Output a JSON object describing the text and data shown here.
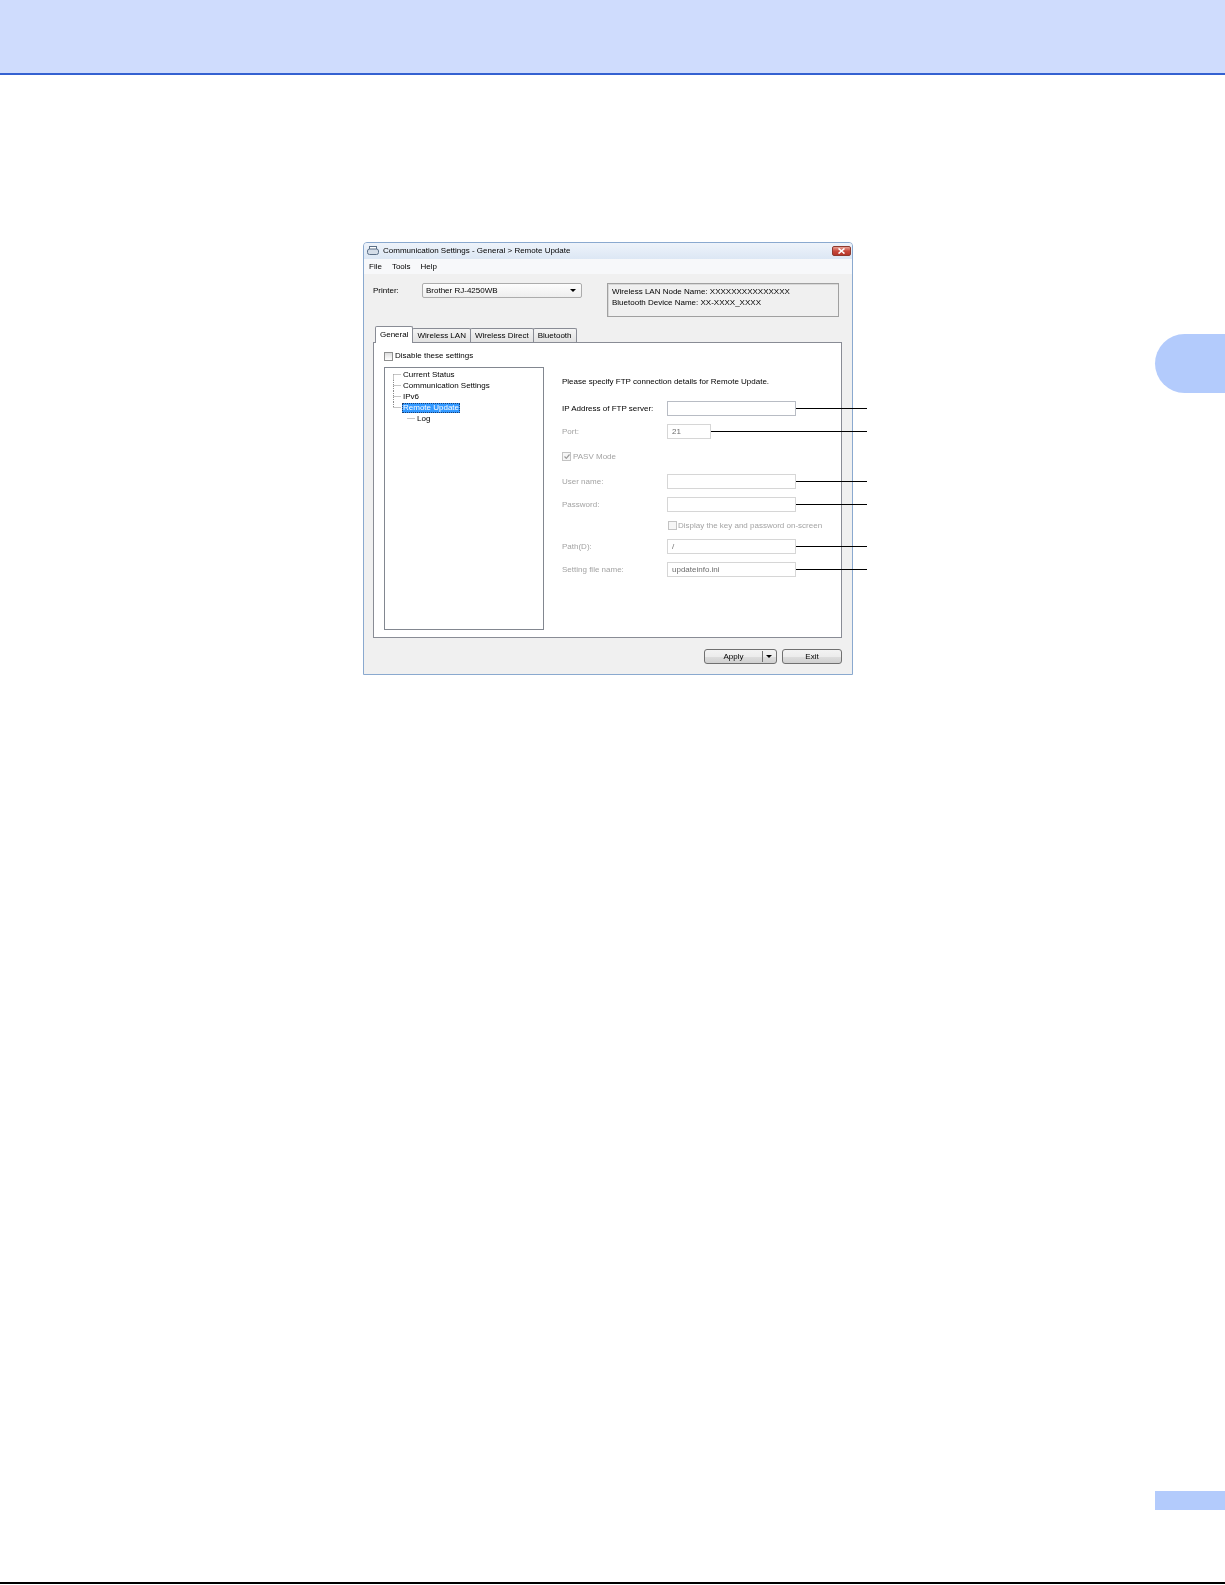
{
  "window": {
    "title": "Communication Settings - General > Remote Update",
    "menu": [
      "File",
      "Tools",
      "Help"
    ]
  },
  "printer": {
    "label": "Printer:",
    "value": "Brother RJ-4250WB"
  },
  "device_info": [
    "Wireless LAN Node Name: XXXXXXXXXXXXXXX",
    "Bluetooth Device Name: XX-XXXX_XXXX"
  ],
  "tabs": [
    {
      "label": "General",
      "selected": true
    },
    {
      "label": "Wireless LAN",
      "selected": false
    },
    {
      "label": "Wireless Direct",
      "selected": false
    },
    {
      "label": "Bluetooth",
      "selected": false
    }
  ],
  "disable_settings": {
    "label": "Disable these settings",
    "checked": false
  },
  "tree": [
    {
      "label": "Current Status",
      "selected": false
    },
    {
      "label": "Communication Settings",
      "selected": false
    },
    {
      "label": "IPv6",
      "selected": false
    },
    {
      "label": "Remote Update",
      "selected": true,
      "children": [
        {
          "label": "Log",
          "selected": false
        }
      ]
    }
  ],
  "instruction": "Please specify FTP connection details for Remote Update.",
  "form": [
    {
      "kind": "field",
      "label": "IP Address of FTP server:",
      "disabled": false,
      "callout": true
    },
    {
      "kind": "shortfield",
      "label": "Port:",
      "value": "21",
      "disabled": true,
      "callout": true
    },
    {
      "kind": "checkbox",
      "label": "PASV Mode",
      "checked": true,
      "disabled": true
    },
    {
      "kind": "field",
      "label": "User name:",
      "disabled": true,
      "callout": true
    },
    {
      "kind": "field",
      "label": "Password:",
      "disabled": true,
      "callout": true
    },
    {
      "kind": "suboption",
      "label": "Display the key and password on-screen",
      "checked": false,
      "disabled": true
    },
    {
      "kind": "field",
      "label": "Path(D):",
      "value": "/",
      "disabled": true,
      "callout": true
    },
    {
      "kind": "field",
      "label": "Setting file name:",
      "value": "updateinfo.ini",
      "disabled": true,
      "callout": true
    }
  ],
  "buttons": [
    {
      "label": "Apply",
      "kind": "split"
    },
    {
      "label": "Exit",
      "kind": "plain"
    }
  ]
}
